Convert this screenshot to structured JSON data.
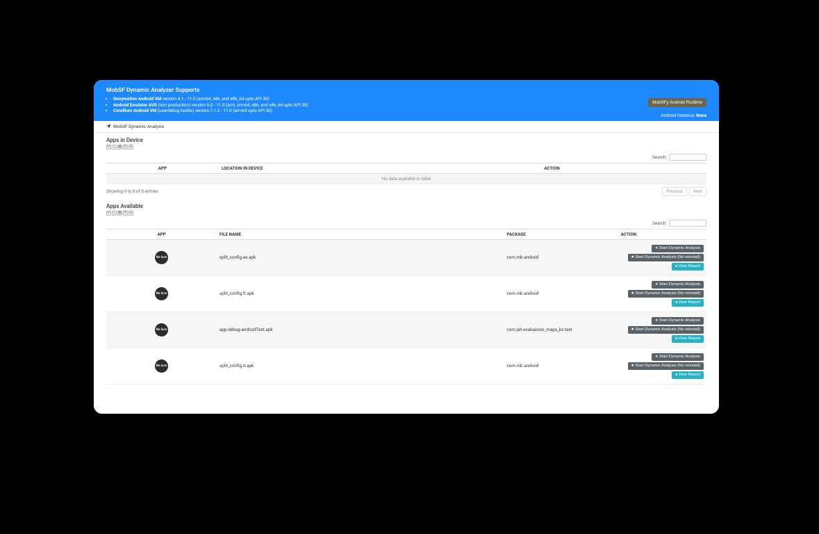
{
  "banner": {
    "title": "MobSF Dynamic Analyzer Supports",
    "bullets": [
      {
        "b": "Genymotion Android VM",
        "rest": " version 4.1 - 11.0 (arm64, x86, and x86_64 upto API 30)"
      },
      {
        "b": "Android Emulator AVD",
        "rest": " (non production) version 5.0 - 11.0 (arm, arm64, x86, and x86_64 upto API 30)"
      },
      {
        "b": "Corellium Android VM",
        "rest": " (userdebug builds) version 7.1.2 - 11.0 (arm64 upto API 30)"
      }
    ],
    "runtime_btn": "MobSFy Android Runtime",
    "instance_label": "Android Instance:",
    "instance_value": "None"
  },
  "breadcrumb": "MobSF Dynamic Analysis",
  "search_label": "Search:",
  "device": {
    "heading": "Apps in Device",
    "cols": {
      "app": "APP",
      "loc": "LOCATION IN DEVICE",
      "action": "ACTION"
    },
    "empty": "No data available in table",
    "showing": "Showing 0 to 0 of 0 entries",
    "prev": "Previous",
    "next": "Next"
  },
  "available": {
    "heading": "Apps Available",
    "cols": {
      "app": "APP",
      "file": "FILE NAME",
      "pkg": "PACKAGE",
      "action": "ACTION"
    },
    "icon_text": "No Icon",
    "btn1": "Start Dynamic Analysis",
    "btn2": "Start Dynamic Analysis (No reinstall)",
    "btn3": "View Report",
    "rows": [
      {
        "file": "split_config.es.apk",
        "pkg": "com.mb.android"
      },
      {
        "file": "split_config.fr.apk",
        "pkg": "com.mb.android"
      },
      {
        "file": "app-debug-androidTest.apk",
        "pkg": "com.jsh.evaluacion_maps_kx.test"
      },
      {
        "file": "split_config.it.apk",
        "pkg": "com.mb.android"
      }
    ]
  }
}
